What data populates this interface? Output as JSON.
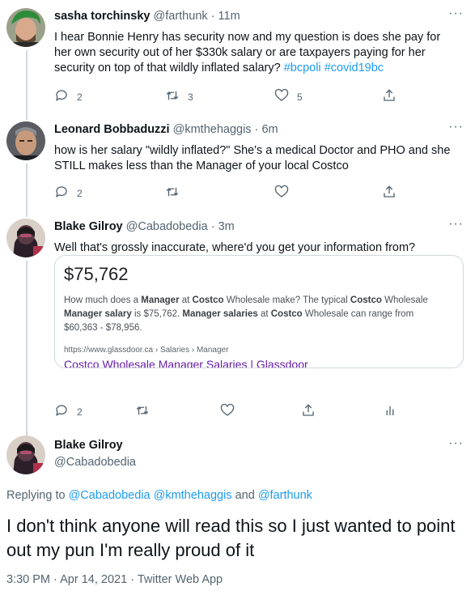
{
  "tweets": [
    {
      "name": "sasha torchinsky",
      "handle": "@farthunk",
      "time": "11m",
      "text": "I hear Bonnie Henry has security now and my question is does she pay for her own security out of her $330k salary or are taxpayers paying for her security on top of that wildly inflated salary? ",
      "hashtags": [
        "#bcpoli",
        "#covid19bc"
      ],
      "reply_count": "2",
      "retweet_count": "3",
      "like_count": "5"
    },
    {
      "name": "Leonard Bobbaduzzi",
      "handle": "@kmthehaggis",
      "time": "6m",
      "text": "how is her salary \"wildly inflated?\" She's a medical Doctor and PHO and she STILL makes less than the Manager of your local Costco",
      "reply_count": "2"
    },
    {
      "name": "Blake Gilroy",
      "handle": "@Cabadobedia",
      "time": "3m",
      "text": "Well that's grossly inaccurate, where'd you get your information from?",
      "reply_count": "2",
      "card": {
        "price": "$75,762",
        "snippet": {
          "s1": "How much does a ",
          "b1": "Manager",
          "s2": " at ",
          "b2": "Costco",
          "s3": " Wholesale make? The typical ",
          "b3": "Costco",
          "s4": " Wholesale ",
          "b4": "Manager salary",
          "s5": " is $75,762. ",
          "b5": "Manager salaries",
          "s6": " at ",
          "b6": "Costco",
          "s7": " Wholesale can range from $60,363 - $78,956."
        },
        "url": "https://www.glassdoor.ca › Salaries › Manager",
        "link_title": "Costco Wholesale Manager Salaries | Glassdoor"
      }
    }
  ],
  "main_tweet": {
    "name": "Blake Gilroy",
    "handle": "@Cabadobedia",
    "replying_prefix": "Replying to",
    "replying_mentions": [
      "@Cabadobedia",
      "@kmthehaggis"
    ],
    "replying_and": "and",
    "replying_last": "@farthunk",
    "text": "I don't think anyone will read this so I just wanted to point out my pun I'm really proud of it",
    "time": "3:30 PM",
    "separator": "·",
    "date": "Apr 14, 2021",
    "source": "Twitter Web App"
  },
  "ui": {
    "more_label": "···",
    "dot": "·"
  },
  "colors": {
    "accent": "#1d9bf0",
    "secondary_text": "#536471",
    "link_visited": "#681da8",
    "border": "#cfd9de"
  },
  "icons": [
    "reply-icon",
    "retweet-icon",
    "like-icon",
    "share-icon",
    "analytics-icon",
    "more-icon"
  ]
}
